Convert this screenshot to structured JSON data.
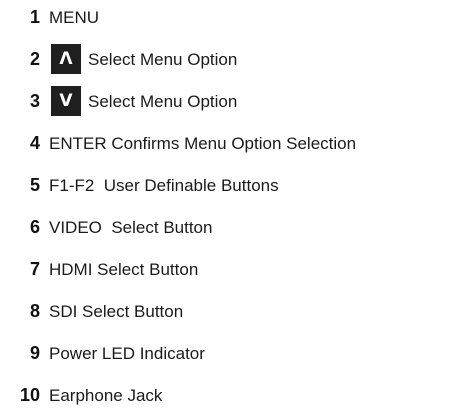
{
  "legend": {
    "items": [
      {
        "number": "1",
        "label": "MENU"
      },
      {
        "number": "2",
        "key": "Λ",
        "label": "Select Menu Option"
      },
      {
        "number": "3",
        "key": "V",
        "label": "Select Menu Option"
      },
      {
        "number": "4",
        "label": "ENTER Confirms Menu Option Selection"
      },
      {
        "number": "5",
        "label": "F1-F2  User Definable Buttons"
      },
      {
        "number": "6",
        "label": "VIDEO  Select Button"
      },
      {
        "number": "7",
        "label": "HDMI Select Button"
      },
      {
        "number": "8",
        "label": "SDI Select Button"
      },
      {
        "number": "9",
        "label": "Power LED Indicator"
      },
      {
        "number": "10",
        "label": "Earphone Jack"
      }
    ]
  }
}
